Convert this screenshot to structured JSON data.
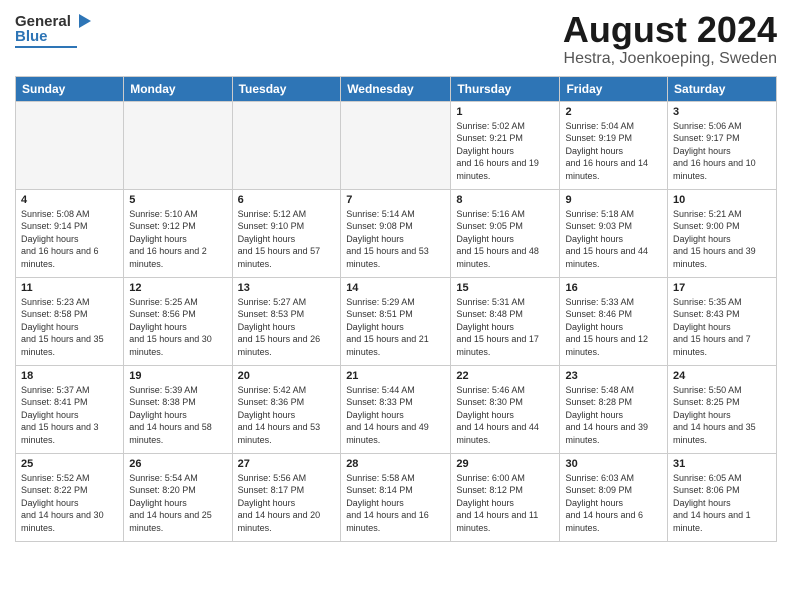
{
  "header": {
    "logo": {
      "general": "General",
      "blue": "Blue"
    },
    "title": "August 2024",
    "subtitle": "Hestra, Joenkoeping, Sweden"
  },
  "days_of_week": [
    "Sunday",
    "Monday",
    "Tuesday",
    "Wednesday",
    "Thursday",
    "Friday",
    "Saturday"
  ],
  "weeks": [
    [
      {
        "day": null,
        "sunrise": null,
        "sunset": null,
        "daylight": null
      },
      {
        "day": null,
        "sunrise": null,
        "sunset": null,
        "daylight": null
      },
      {
        "day": null,
        "sunrise": null,
        "sunset": null,
        "daylight": null
      },
      {
        "day": null,
        "sunrise": null,
        "sunset": null,
        "daylight": null
      },
      {
        "day": "1",
        "sunrise": "5:02 AM",
        "sunset": "9:21 PM",
        "daylight": "16 hours and 19 minutes."
      },
      {
        "day": "2",
        "sunrise": "5:04 AM",
        "sunset": "9:19 PM",
        "daylight": "16 hours and 14 minutes."
      },
      {
        "day": "3",
        "sunrise": "5:06 AM",
        "sunset": "9:17 PM",
        "daylight": "16 hours and 10 minutes."
      }
    ],
    [
      {
        "day": "4",
        "sunrise": "5:08 AM",
        "sunset": "9:14 PM",
        "daylight": "16 hours and 6 minutes."
      },
      {
        "day": "5",
        "sunrise": "5:10 AM",
        "sunset": "9:12 PM",
        "daylight": "16 hours and 2 minutes."
      },
      {
        "day": "6",
        "sunrise": "5:12 AM",
        "sunset": "9:10 PM",
        "daylight": "15 hours and 57 minutes."
      },
      {
        "day": "7",
        "sunrise": "5:14 AM",
        "sunset": "9:08 PM",
        "daylight": "15 hours and 53 minutes."
      },
      {
        "day": "8",
        "sunrise": "5:16 AM",
        "sunset": "9:05 PM",
        "daylight": "15 hours and 48 minutes."
      },
      {
        "day": "9",
        "sunrise": "5:18 AM",
        "sunset": "9:03 PM",
        "daylight": "15 hours and 44 minutes."
      },
      {
        "day": "10",
        "sunrise": "5:21 AM",
        "sunset": "9:00 PM",
        "daylight": "15 hours and 39 minutes."
      }
    ],
    [
      {
        "day": "11",
        "sunrise": "5:23 AM",
        "sunset": "8:58 PM",
        "daylight": "15 hours and 35 minutes."
      },
      {
        "day": "12",
        "sunrise": "5:25 AM",
        "sunset": "8:56 PM",
        "daylight": "15 hours and 30 minutes."
      },
      {
        "day": "13",
        "sunrise": "5:27 AM",
        "sunset": "8:53 PM",
        "daylight": "15 hours and 26 minutes."
      },
      {
        "day": "14",
        "sunrise": "5:29 AM",
        "sunset": "8:51 PM",
        "daylight": "15 hours and 21 minutes."
      },
      {
        "day": "15",
        "sunrise": "5:31 AM",
        "sunset": "8:48 PM",
        "daylight": "15 hours and 17 minutes."
      },
      {
        "day": "16",
        "sunrise": "5:33 AM",
        "sunset": "8:46 PM",
        "daylight": "15 hours and 12 minutes."
      },
      {
        "day": "17",
        "sunrise": "5:35 AM",
        "sunset": "8:43 PM",
        "daylight": "15 hours and 7 minutes."
      }
    ],
    [
      {
        "day": "18",
        "sunrise": "5:37 AM",
        "sunset": "8:41 PM",
        "daylight": "15 hours and 3 minutes."
      },
      {
        "day": "19",
        "sunrise": "5:39 AM",
        "sunset": "8:38 PM",
        "daylight": "14 hours and 58 minutes."
      },
      {
        "day": "20",
        "sunrise": "5:42 AM",
        "sunset": "8:36 PM",
        "daylight": "14 hours and 53 minutes."
      },
      {
        "day": "21",
        "sunrise": "5:44 AM",
        "sunset": "8:33 PM",
        "daylight": "14 hours and 49 minutes."
      },
      {
        "day": "22",
        "sunrise": "5:46 AM",
        "sunset": "8:30 PM",
        "daylight": "14 hours and 44 minutes."
      },
      {
        "day": "23",
        "sunrise": "5:48 AM",
        "sunset": "8:28 PM",
        "daylight": "14 hours and 39 minutes."
      },
      {
        "day": "24",
        "sunrise": "5:50 AM",
        "sunset": "8:25 PM",
        "daylight": "14 hours and 35 minutes."
      }
    ],
    [
      {
        "day": "25",
        "sunrise": "5:52 AM",
        "sunset": "8:22 PM",
        "daylight": "14 hours and 30 minutes."
      },
      {
        "day": "26",
        "sunrise": "5:54 AM",
        "sunset": "8:20 PM",
        "daylight": "14 hours and 25 minutes."
      },
      {
        "day": "27",
        "sunrise": "5:56 AM",
        "sunset": "8:17 PM",
        "daylight": "14 hours and 20 minutes."
      },
      {
        "day": "28",
        "sunrise": "5:58 AM",
        "sunset": "8:14 PM",
        "daylight": "14 hours and 16 minutes."
      },
      {
        "day": "29",
        "sunrise": "6:00 AM",
        "sunset": "8:12 PM",
        "daylight": "14 hours and 11 minutes."
      },
      {
        "day": "30",
        "sunrise": "6:03 AM",
        "sunset": "8:09 PM",
        "daylight": "14 hours and 6 minutes."
      },
      {
        "day": "31",
        "sunrise": "6:05 AM",
        "sunset": "8:06 PM",
        "daylight": "14 hours and 1 minute."
      }
    ]
  ]
}
